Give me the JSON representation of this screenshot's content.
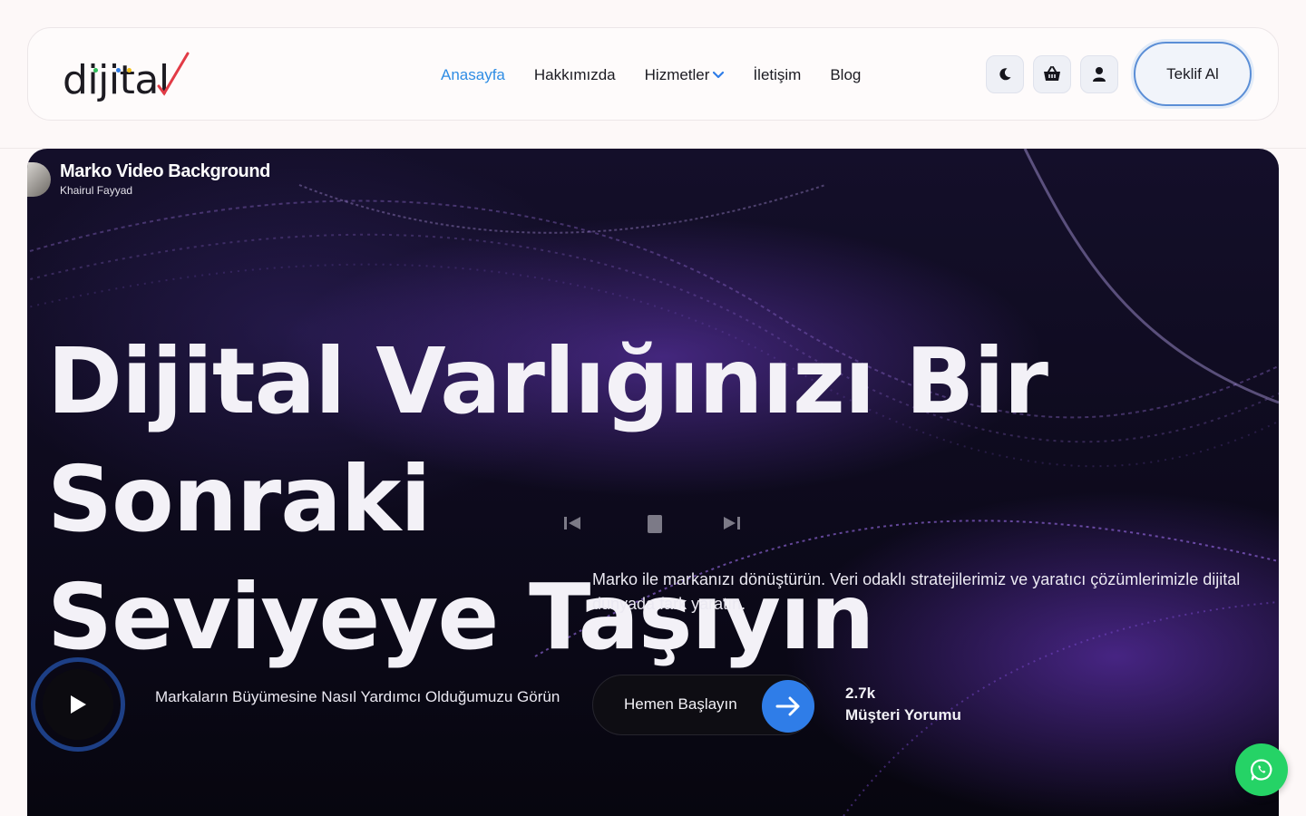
{
  "header": {
    "logo_text": "dijital",
    "nav": [
      {
        "label": "Anasayfa"
      },
      {
        "label": "Hakkımızda"
      },
      {
        "label": "Hizmetler"
      },
      {
        "label": "İletişim"
      },
      {
        "label": "Blog"
      }
    ],
    "active_nav": "Anasayfa",
    "icons": [
      "moon-icon",
      "basket-icon",
      "user-icon"
    ],
    "cta_label": "Teklif Al"
  },
  "video": {
    "title": "Marko Video Background",
    "author": "Khairul Fayyad"
  },
  "hero": {
    "headline_line1": "Dijital Varlığınızı Bir Sonraki",
    "headline_line2": "Seviyeye Taşıyın",
    "description": "Marko ile markanızı dönüştürün. Veri odaklı stratejilerimiz ve yaratıcı çözümlerimizle dijital dünyada fark yaratın.",
    "play_label": "Markaların Büyümesine Nasıl Yardımcı Olduğumuzu Görün",
    "start_label": "Hemen Başlayın",
    "stat_value": "2.7k",
    "stat_label": "Müşteri Yorumu"
  },
  "colors": {
    "accent": "#2f8de4",
    "button_blue": "#2f7de8",
    "whatsapp": "#25d366"
  }
}
